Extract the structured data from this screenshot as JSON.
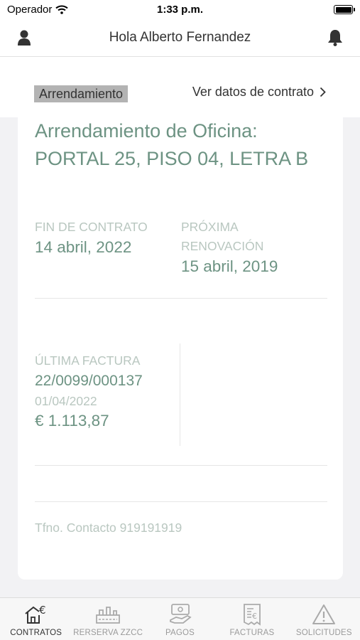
{
  "status_bar": {
    "carrier": "Operador",
    "time": "1:33 p.m."
  },
  "header": {
    "title": "Hola Alberto Fernandez",
    "left_icon": "user-icon",
    "right_icon": "bell-icon"
  },
  "contract_bar": {
    "tag": "Arrendamiento",
    "link": "Ver datos de contrato"
  },
  "contract": {
    "title": "Arrendamiento de Oficina: PORTAL 25, PISO 04, LETRA B",
    "end_label": "FIN DE CONTRATO",
    "end_value": "14 abril, 2022",
    "renewal_label": "PRÓXIMA RENOVACIÓN",
    "renewal_value": "15 abril, 2019",
    "invoice_label": "ÚLTIMA FACTURA",
    "invoice_number": "22/0099/000137",
    "invoice_date": "01/04/2022",
    "invoice_amount": "€ 1.113,87",
    "phone": "Tfno. Contacto 919191919"
  },
  "colors": {
    "accent": "#6d9383",
    "muted": "#b9c7c0",
    "tag_bg": "#b3b3b3"
  },
  "tabs": [
    {
      "label": "CONTRATOS",
      "icon": "contracts-icon",
      "active": true
    },
    {
      "label": "RERSERVA ZZCC",
      "icon": "facilities-icon",
      "active": false
    },
    {
      "label": "PAGOS",
      "icon": "payments-icon",
      "active": false
    },
    {
      "label": "FACTURAS",
      "icon": "invoices-icon",
      "active": false
    },
    {
      "label": "SOLICITUDES",
      "icon": "warning-icon",
      "active": false
    }
  ]
}
